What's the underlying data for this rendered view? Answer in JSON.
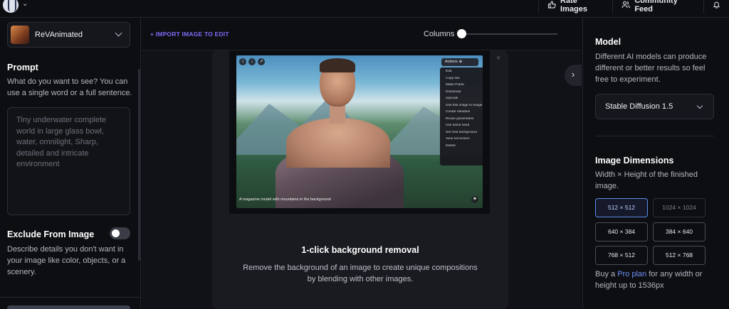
{
  "topbar": {
    "rate_label": "Rate Images",
    "community_label": "Community Feed"
  },
  "left": {
    "model_name": "ReVAnimated",
    "prompt_title": "Prompt",
    "prompt_desc": "What do you want to see? You can use a single word or a full sentence.",
    "prompt_placeholder": "Tiny underwater complete world in large glass bowl, water, omnilight, Sharp, detailed and intricate environment",
    "exclude_title": "Exclude From Image",
    "exclude_desc": "Describe details you don't want in your image like color, objects, or a scenery."
  },
  "center": {
    "import_label": "+ IMPORT IMAGE TO EDIT",
    "columns_label": "Columns",
    "columns_value": 0,
    "card_close": "×",
    "image_caption": "A magazine model with mountains in the background",
    "actions_label": "Actions ⊕",
    "actions_menu": [
      "Edit",
      "Copy link",
      "Make Public",
      "Download",
      "Upscale",
      "Use this image to image",
      "Create Variation",
      "Reuse parameters",
      "Use same seed",
      "Set new background",
      "View full screen",
      "Delete"
    ],
    "collapse_icon": "›",
    "card_title": "1-click background removal",
    "card_desc": "Remove the background of an image to create unique compositions by blending with other images."
  },
  "right": {
    "model_title": "Model",
    "model_desc": "Different AI models can produce different or better results so feel free to experiment.",
    "model_value": "Stable Diffusion 1.5",
    "dims_title": "Image Dimensions",
    "dims_desc": "Width × Height of the finished image.",
    "dims": [
      {
        "label": "512 × 512",
        "state": "selected"
      },
      {
        "label": "1024 × 1024",
        "state": "disabled"
      },
      {
        "label": "640 × 384",
        "state": "normal"
      },
      {
        "label": "384 × 640",
        "state": "normal"
      },
      {
        "label": "768 × 512",
        "state": "normal"
      },
      {
        "label": "512 × 768",
        "state": "normal"
      }
    ],
    "pro_prefix": "Buy a ",
    "pro_link": "Pro plan",
    "pro_suffix": " for any width or height up to 1536px"
  },
  "colors": {
    "accent": "#7b6cf6",
    "selected_border": "#5b8fe8",
    "link": "#6f8ff4"
  },
  "icons": [
    "logo-icon",
    "chevron-down-icon",
    "thumbs-up-icon",
    "users-icon",
    "bell-icon",
    "close-icon",
    "chevron-right-icon"
  ]
}
